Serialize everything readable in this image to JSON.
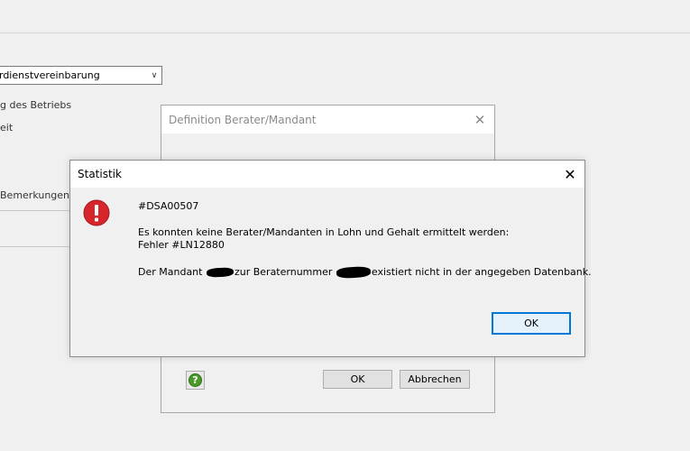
{
  "background": {
    "select_value": "rdienstvereinbarung",
    "labels": [
      "g des Betriebs",
      "eit",
      "Bemerkungen a"
    ]
  },
  "back_dialog": {
    "title": "Definition Berater/Mandant",
    "ok_label": "OK",
    "cancel_label": "Abbrechen"
  },
  "statistik_dialog": {
    "title": "Statistik",
    "code": "#DSA00507",
    "line1": "Es konnten keine Berater/Mandanten in Lohn und Gehalt ermittelt werden:",
    "line2": "Fehler #LN12880",
    "line3_part1": "Der Mandant",
    "line3_part2": "zur Beraternummer",
    "line3_part3": "existiert nicht in der angegeben Datenbank.",
    "ok_label": "OK"
  },
  "colors": {
    "error_red": "#d7262b",
    "help_green": "#4a9a2a",
    "focus_blue": "#0078d7"
  }
}
